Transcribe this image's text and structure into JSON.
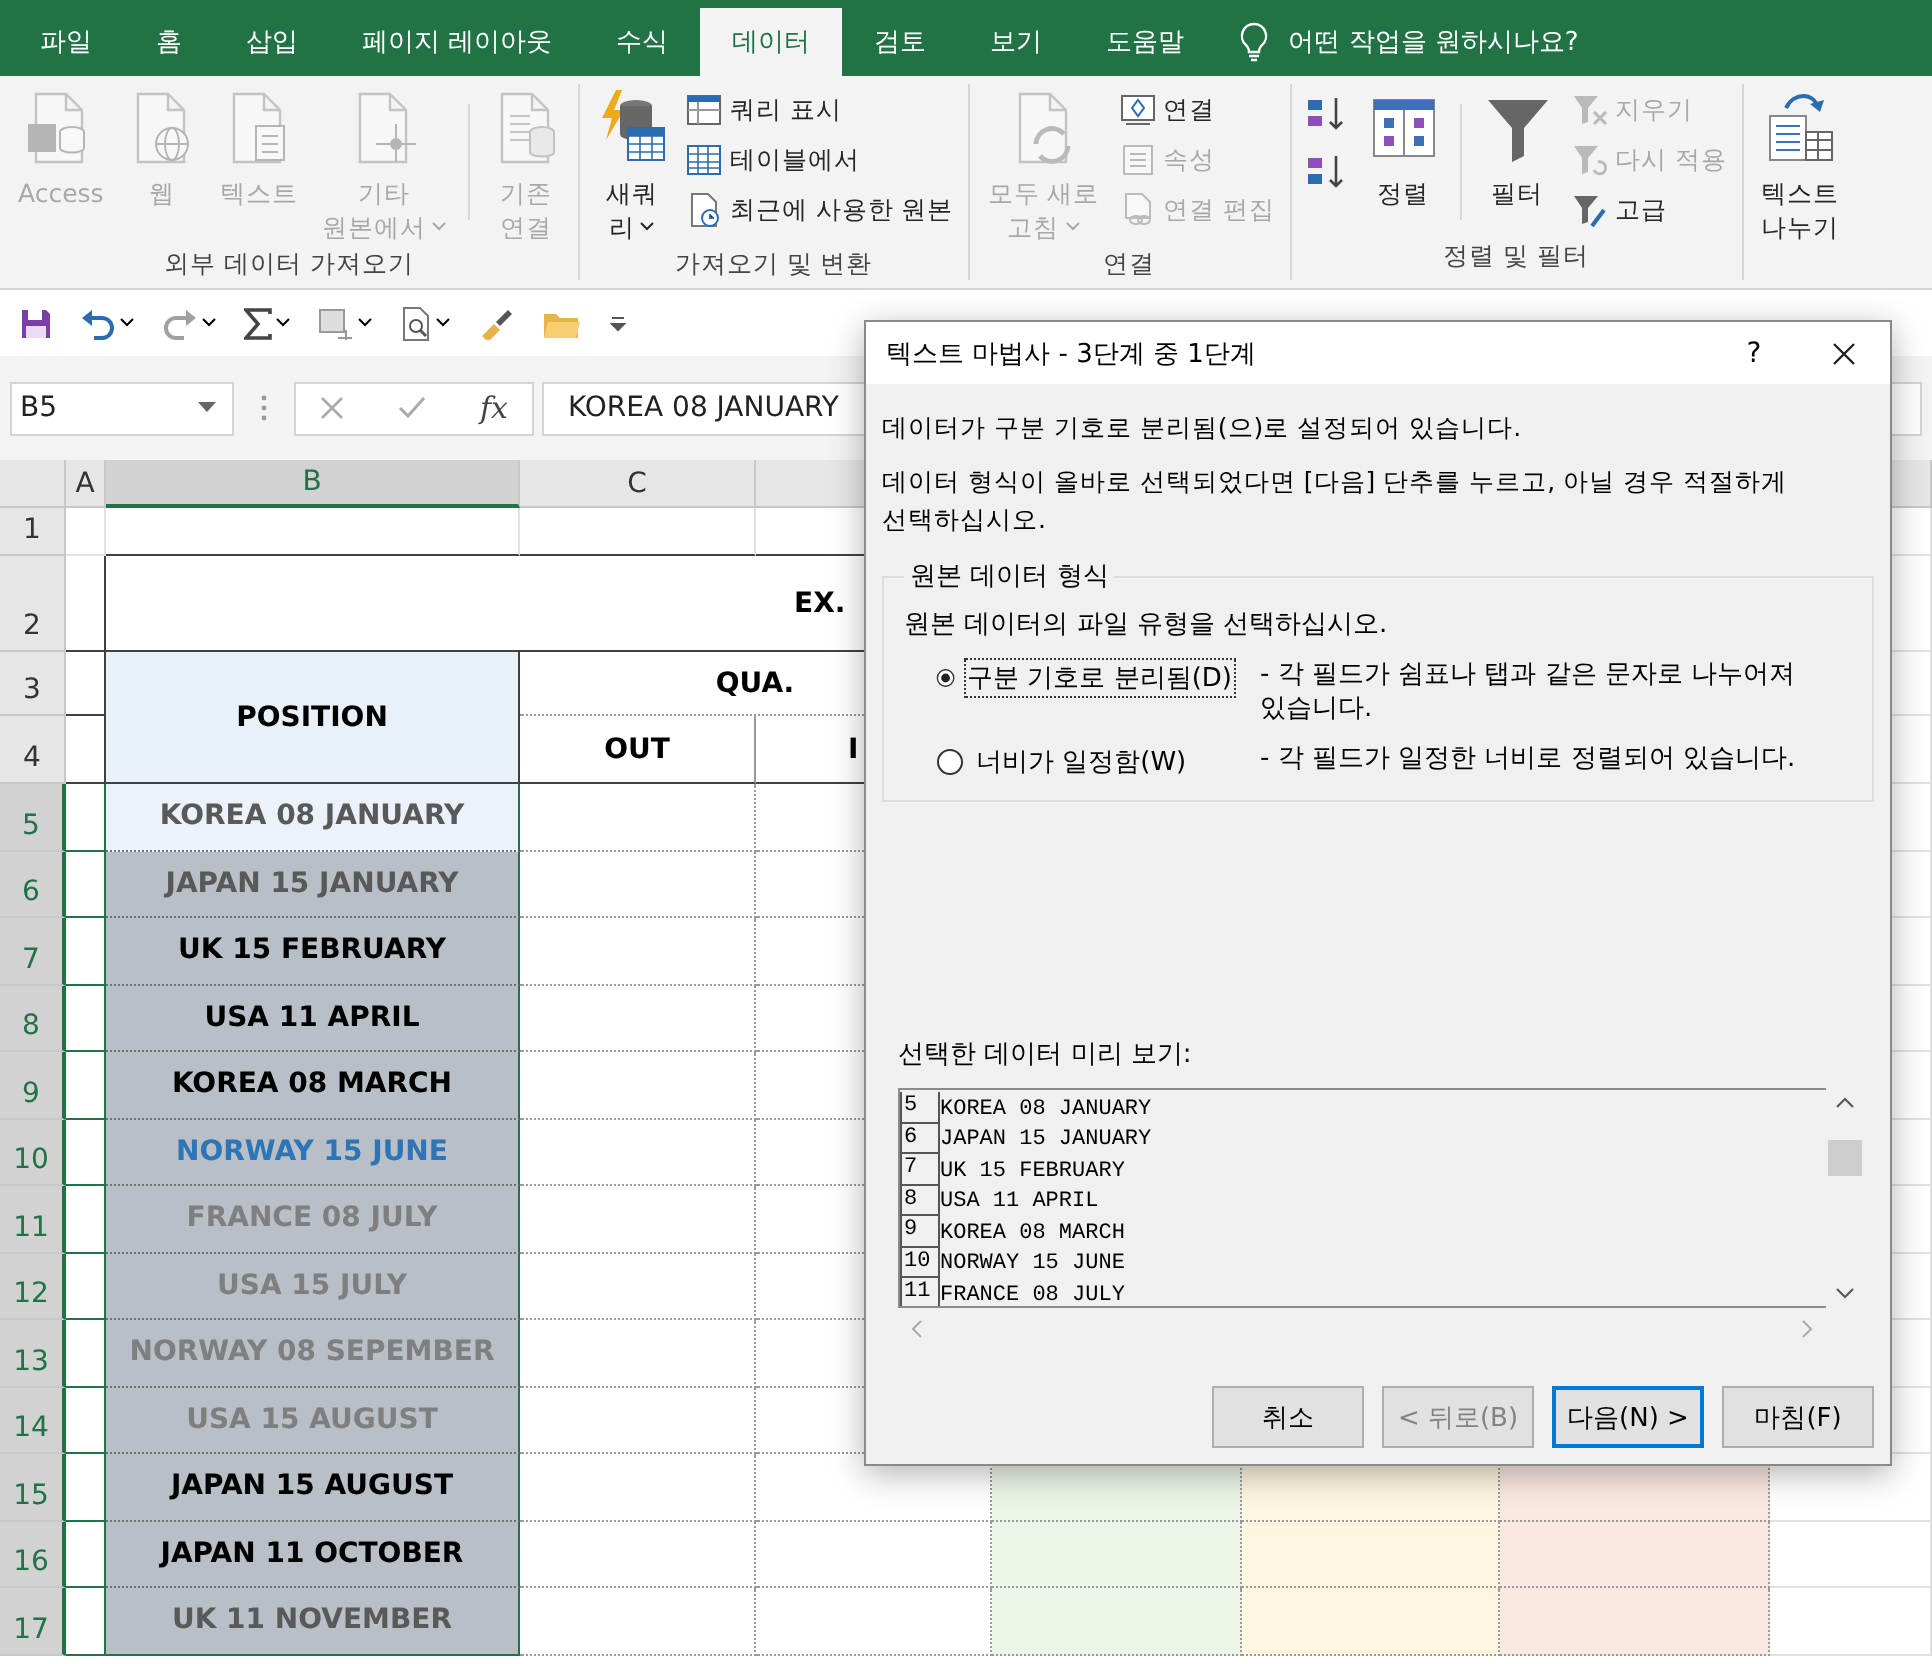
{
  "tabs": [
    {
      "label": "파일",
      "selected": false
    },
    {
      "label": "홈",
      "selected": false
    },
    {
      "label": "삽입",
      "selected": false
    },
    {
      "label": "페이지 레이아웃",
      "selected": false
    },
    {
      "label": "수식",
      "selected": false
    },
    {
      "label": "데이터",
      "selected": true
    },
    {
      "label": "검토",
      "selected": false
    },
    {
      "label": "보기",
      "selected": false
    },
    {
      "label": "도움말",
      "selected": false
    }
  ],
  "tell_me": {
    "placeholder": "어떤 작업을 원하시나요?"
  },
  "ribbon": {
    "groups": [
      {
        "label": "외부 데이터 가져오기",
        "columns": [
          {
            "kind": "large",
            "lines": [
              "Access"
            ],
            "disabled": true
          },
          {
            "kind": "large",
            "lines": [
              "웹"
            ],
            "disabled": true
          },
          {
            "kind": "large",
            "lines": [
              "텍스트"
            ],
            "disabled": true
          },
          {
            "kind": "large",
            "lines": [
              "기타",
              "원본에서"
            ],
            "disabled": true,
            "dropdown": true
          },
          {
            "kind": "separator"
          },
          {
            "kind": "large",
            "lines": [
              "기존",
              "연결"
            ],
            "disabled": true
          }
        ]
      },
      {
        "label": "가져오기 및 변환",
        "columns": [
          {
            "kind": "large",
            "lines": [
              "새쿼",
              "리"
            ],
            "disabled": false,
            "dropdown": true
          },
          {
            "kind": "stack",
            "items": [
              {
                "label": "쿼리 표시",
                "disabled": false
              },
              {
                "label": "테이블에서",
                "disabled": false
              },
              {
                "label": "최근에 사용한 원본",
                "disabled": false
              }
            ]
          }
        ]
      },
      {
        "label": "연결",
        "columns": [
          {
            "kind": "large",
            "lines": [
              "모두 새로",
              "고침"
            ],
            "disabled": true,
            "dropdown": true
          },
          {
            "kind": "stack",
            "items": [
              {
                "label": "연결",
                "disabled": false
              },
              {
                "label": "속성",
                "disabled": true
              },
              {
                "label": "연결 편집",
                "disabled": true
              }
            ]
          }
        ]
      },
      {
        "label": "정렬 및 필터",
        "columns": [
          {
            "kind": "sort_pair"
          },
          {
            "kind": "large",
            "lines": [
              "정렬"
            ],
            "disabled": false
          },
          {
            "kind": "separator"
          },
          {
            "kind": "large",
            "lines": [
              "필터"
            ],
            "disabled": false
          },
          {
            "kind": "stack",
            "items": [
              {
                "label": "지우기",
                "disabled": true
              },
              {
                "label": "다시 적용",
                "disabled": true
              },
              {
                "label": "고급",
                "disabled": false
              }
            ]
          }
        ]
      },
      {
        "columns": [
          {
            "kind": "large",
            "lines": [
              "텍스트",
              "나누기"
            ],
            "disabled": false
          }
        ]
      }
    ]
  },
  "sheet": {
    "name_box": {
      "value": "B5"
    },
    "fx": "fx",
    "formula": {
      "value": "KOREA 08 JANUARY"
    },
    "columns": [
      {
        "label": "A",
        "selected": false
      },
      {
        "label": "B",
        "selected": true
      },
      {
        "label": "C",
        "selected": false
      }
    ],
    "rows": [
      {
        "label": "1",
        "selected": false
      },
      {
        "label": "2",
        "selected": false
      },
      {
        "label": "3",
        "selected": false
      },
      {
        "label": "4",
        "selected": false
      },
      {
        "label": "5",
        "selected": true
      },
      {
        "label": "6",
        "selected": true
      },
      {
        "label": "7",
        "selected": true
      },
      {
        "label": "8",
        "selected": true
      },
      {
        "label": "9",
        "selected": true
      },
      {
        "label": "10",
        "selected": true
      },
      {
        "label": "11",
        "selected": true
      },
      {
        "label": "12",
        "selected": true
      },
      {
        "label": "13",
        "selected": true
      },
      {
        "label": "14",
        "selected": true
      },
      {
        "label": "15",
        "selected": true
      },
      {
        "label": "16",
        "selected": true
      },
      {
        "label": "17",
        "selected": true
      }
    ],
    "title": "EX.",
    "header": {
      "position": "POSITION",
      "qua": "QUA.",
      "out": "OUT",
      "in": "I"
    },
    "positions": [
      {
        "text": "KOREA 08 JANUARY",
        "color": "#595959",
        "active": true
      },
      {
        "text": "JAPAN 15 JANUARY",
        "color": "#595959",
        "active": false
      },
      {
        "text": "UK 15 FEBRUARY",
        "color": "#000000",
        "active": false
      },
      {
        "text": "USA 11 APRIL",
        "color": "#000000",
        "active": false
      },
      {
        "text": "KOREA 08 MARCH",
        "color": "#000000",
        "active": false
      },
      {
        "text": "NORWAY 15 JUNE",
        "color": "#2e75b6",
        "active": false
      },
      {
        "text": "FRANCE 08 JULY",
        "color": "#7f7f7f",
        "active": false
      },
      {
        "text": "USA 15 JULY",
        "color": "#7f7f7f",
        "active": false
      },
      {
        "text": "NORWAY 08 SEPEMBER",
        "color": "#7f7f7f",
        "active": false
      },
      {
        "text": "USA 15 AUGUST",
        "color": "#7f7f7f",
        "active": false
      },
      {
        "text": "JAPAN 15 AUGUST",
        "color": "#000000",
        "active": false
      },
      {
        "text": "JAPAN 11 OCTOBER",
        "color": "#000000",
        "active": false
      },
      {
        "text": "UK 11 NOVEMBER",
        "color": "#595959",
        "active": false
      }
    ],
    "fills": [
      {
        "color": "#edf5e8"
      },
      {
        "color": "#fef6e0"
      },
      {
        "color": "#fbe8e0"
      }
    ]
  },
  "dialog": {
    "title": "텍스트 마법사 - 3단계 중 1단계",
    "help": "?",
    "intro": "데이터가 구분 기호로 분리됨(으)로 설정되어 있습니다.",
    "instruction": "데이터 형식이 올바로 선택되었다면 [다음] 단추를 누르고, 아닐 경우 적절하게 선택하십시오.",
    "group": {
      "legend": "원본 데이터 형식",
      "prompt": "원본 데이터의 파일 유형을 선택하십시오.",
      "options": [
        {
          "label": "구분 기호로 분리됨(D)",
          "description": "- 각 필드가 쉼표나 탭과 같은 문자로 나누어져 있습니다.",
          "selected": true,
          "focused": true
        },
        {
          "label": "너비가 일정함(W)",
          "description": "- 각 필드가 일정한 너비로 정렬되어 있습니다.",
          "selected": false,
          "focused": false
        }
      ]
    },
    "preview": {
      "label": "선택한 데이터 미리 보기:",
      "rows": [
        {
          "number": "5",
          "text": "KOREA 08 JANUARY"
        },
        {
          "number": "6",
          "text": "JAPAN 15 JANUARY"
        },
        {
          "number": "7",
          "text": "UK 15 FEBRUARY"
        },
        {
          "number": "8",
          "text": "USA 11 APRIL"
        },
        {
          "number": "9",
          "text": "KOREA 08 MARCH"
        },
        {
          "number": "10",
          "text": "NORWAY 15 JUNE"
        },
        {
          "number": "11",
          "text": "FRANCE 08 JULY"
        }
      ]
    },
    "buttons": [
      {
        "label": "취소",
        "disabled": false,
        "default": false
      },
      {
        "label": "< 뒤로(B)",
        "disabled": true,
        "default": false
      },
      {
        "label": "다음(N) >",
        "disabled": false,
        "default": true
      },
      {
        "label": "마침(F)",
        "disabled": false,
        "default": false
      }
    ]
  }
}
